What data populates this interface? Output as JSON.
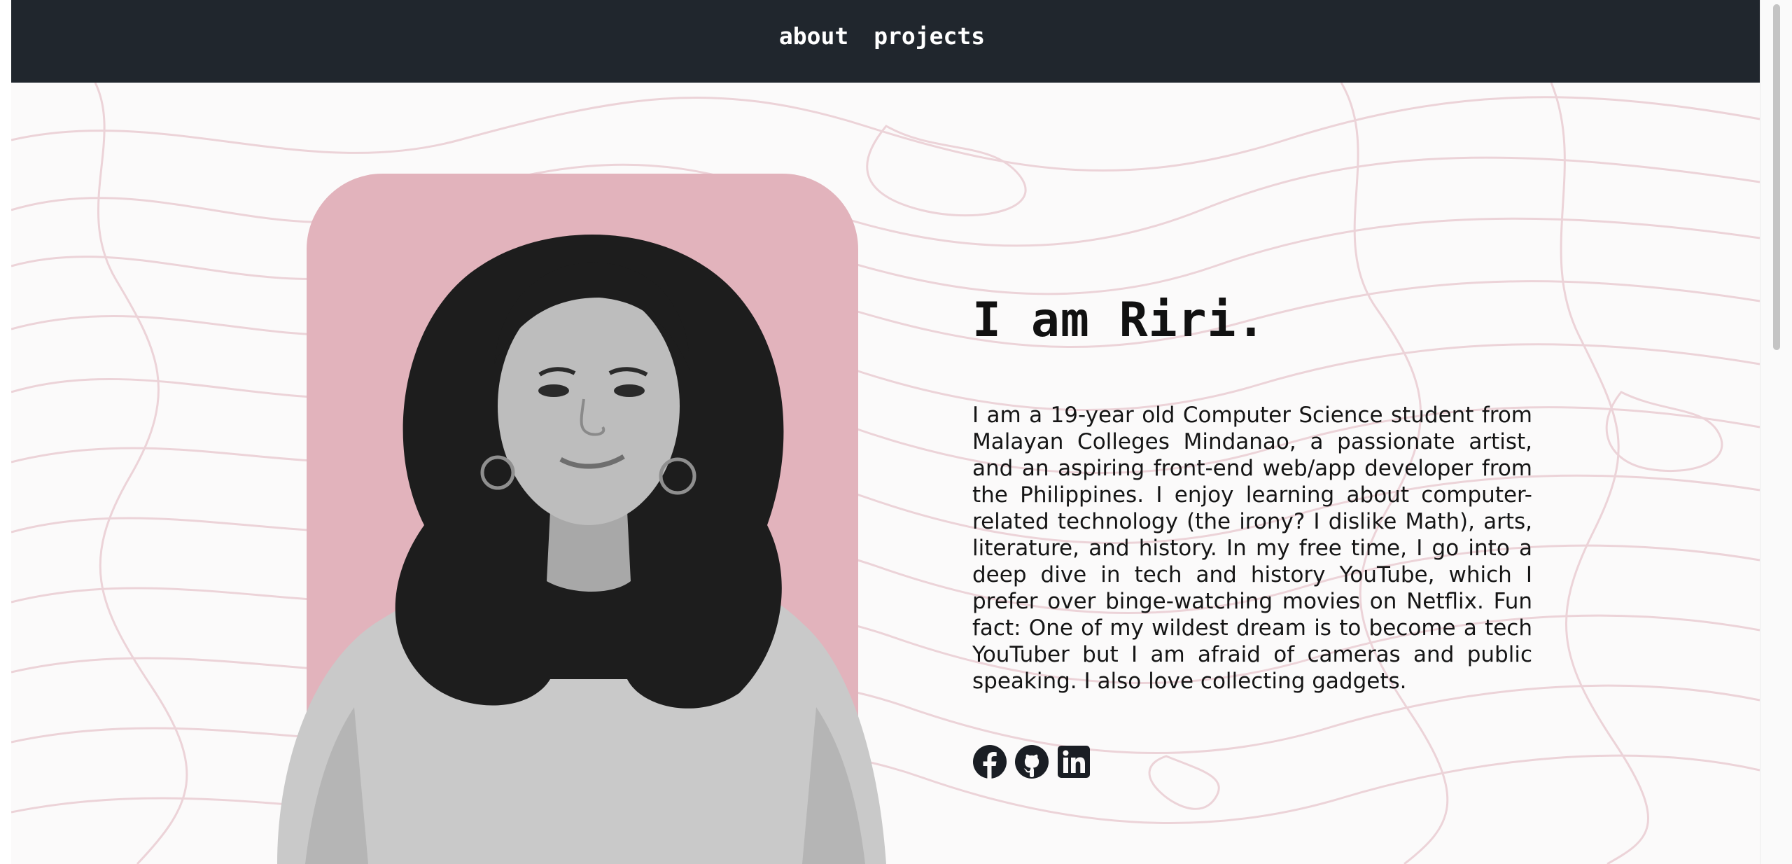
{
  "nav": {
    "about_label": "about",
    "projects_label": "projects"
  },
  "hero": {
    "heading": "I am Riri.",
    "bio": "I am a 19-year old Computer Science student from Malayan Colleges Mindanao, a passionate artist, and an aspiring front-end web/app developer from the Philippines. I enjoy learning about computer-related technology (the irony? I dislike Math), arts, literature, and history. In my free time, I go into a deep dive in tech and history YouTube, which I prefer over binge-watching movies on Netflix. Fun fact: One of my wildest dream is to become a tech YouTuber but I am afraid of cameras and public speaking. I also love collecting gadgets.",
    "socials": [
      {
        "icon": "facebook-icon"
      },
      {
        "icon": "github-icon"
      },
      {
        "icon": "linkedin-icon"
      }
    ]
  },
  "colors": {
    "navbar": "#20262d",
    "photo_card": "#e2b3bc",
    "topo_lines": "#ecd3d8"
  }
}
